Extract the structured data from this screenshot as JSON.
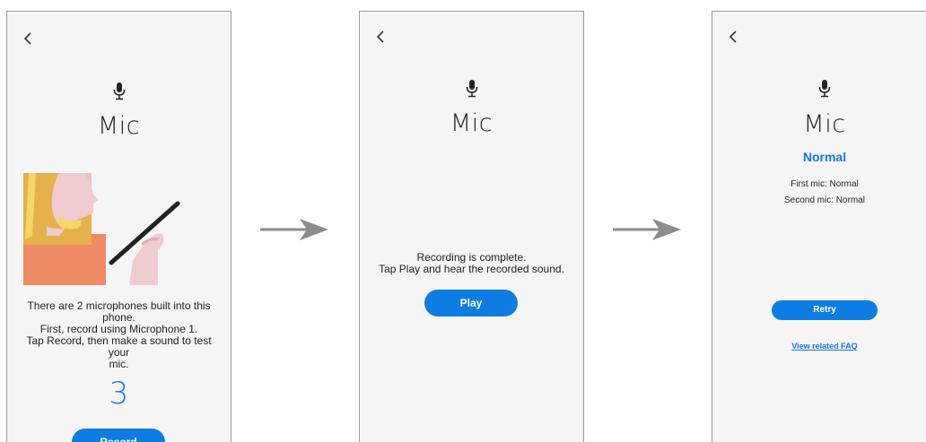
{
  "screens": [
    {
      "title": "Mic",
      "description_lines": [
        "There are 2 microphones built into this",
        "phone.",
        "First, record using Microphone 1.",
        "Tap Record, then make a sound to test your",
        "mic."
      ],
      "countdown": "3",
      "button_label": "Record"
    },
    {
      "title": "Mic",
      "message_lines": [
        "Recording is complete.",
        "Tap Play and hear the recorded sound."
      ],
      "button_label": "Play"
    },
    {
      "title": "Mic",
      "status": "Normal",
      "results": [
        "First mic: Normal",
        "Second mic: Normal"
      ],
      "button_label": "Retry",
      "link_label": "View related FAQ"
    }
  ],
  "colors": {
    "accent": "#0d7de3",
    "status_blue": "#1a73e8",
    "screen_bg": "#f5f5f5",
    "arrow_gray": "#8c8c8c"
  },
  "icons": {
    "back": "chevron-left-icon",
    "mic": "microphone-icon",
    "arrow": "arrow-right-icon"
  }
}
